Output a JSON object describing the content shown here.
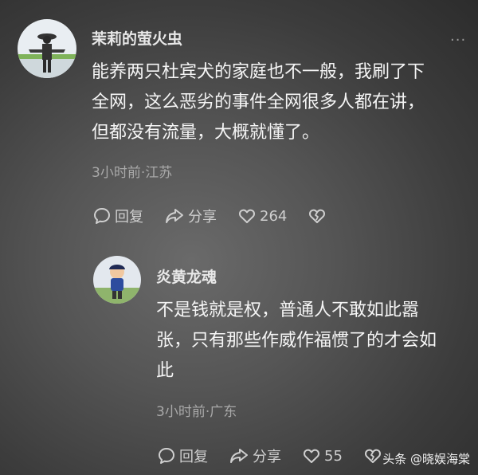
{
  "comments": [
    {
      "username": "茉莉的萤火虫",
      "lines": [
        "能养两只杜宾犬的家庭也不一般，我刷了下",
        "全网，这么恶劣的事件全网很多人都在讲，",
        "但都没有流量，大概就懂了。"
      ],
      "meta": "3小时前·江苏",
      "reply_label": "回复",
      "share_label": "分享",
      "like_count": "264"
    },
    {
      "username": "炎黄龙魂",
      "lines": [
        "不是钱就是权，普通人不敢如此嚣",
        "张，只有那些作威作福惯了的才会如",
        "此"
      ],
      "meta": "3小时前·广东",
      "reply_label": "回复",
      "share_label": "分享",
      "like_count": "55"
    }
  ],
  "more_icon": "more-dots-icon",
  "watermark": "头条 @晓娱海棠"
}
